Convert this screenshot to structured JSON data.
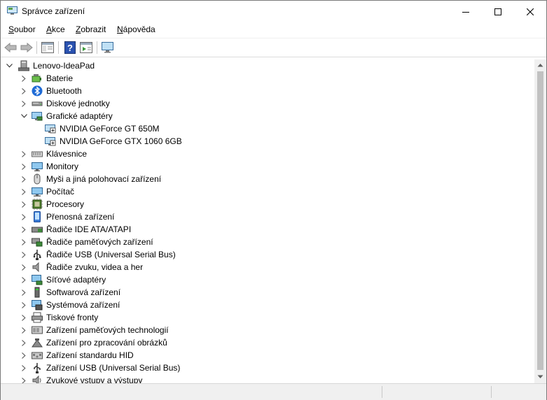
{
  "window": {
    "title": "Správce zařízení"
  },
  "menu": [
    {
      "label": "Soubor",
      "ul": "S",
      "rest": "oubor"
    },
    {
      "label": "Akce",
      "ul": "A",
      "rest": "kce"
    },
    {
      "label": "Zobrazit",
      "ul": "Z",
      "rest": "obrazit"
    },
    {
      "label": "Nápověda",
      "ul": "N",
      "rest": "ápověda"
    }
  ],
  "tree": {
    "root": "Lenovo-IdeaPad",
    "categories": [
      {
        "label": "Baterie",
        "icon": "battery-icon"
      },
      {
        "label": "Bluetooth",
        "icon": "bluetooth-icon"
      },
      {
        "label": "Diskové jednotky",
        "icon": "disk-drive-icon"
      },
      {
        "label": "Grafické adaptéry",
        "icon": "display-adapter-icon",
        "expanded": true,
        "children": [
          "NVIDIA GeForce GT 650M",
          "NVIDIA GeForce GTX 1060 6GB"
        ]
      },
      {
        "label": "Klávesnice",
        "icon": "keyboard-icon"
      },
      {
        "label": "Monitory",
        "icon": "monitor-icon"
      },
      {
        "label": "Myši a jiná polohovací zařízení",
        "icon": "mouse-icon"
      },
      {
        "label": "Počítač",
        "icon": "computer-icon"
      },
      {
        "label": "Procesory",
        "icon": "processor-icon"
      },
      {
        "label": "Přenosná zařízení",
        "icon": "portable-device-icon"
      },
      {
        "label": "Řadiče IDE ATA/ATAPI",
        "icon": "ide-controller-icon"
      },
      {
        "label": "Řadiče paměťových zařízení",
        "icon": "storage-controller-icon"
      },
      {
        "label": "Řadiče USB (Universal Serial Bus)",
        "icon": "usb-icon"
      },
      {
        "label": "Řadiče zvuku, videa a her",
        "icon": "speaker-icon"
      },
      {
        "label": "Síťové adaptéry",
        "icon": "network-adapter-icon"
      },
      {
        "label": "Softwarová zařízení",
        "icon": "software-device-icon"
      },
      {
        "label": "Systémová zařízení",
        "icon": "system-device-icon"
      },
      {
        "label": "Tiskové fronty",
        "icon": "printer-icon"
      },
      {
        "label": "Zařízení paměťových technologií",
        "icon": "memory-technology-icon"
      },
      {
        "label": "Zařízení pro zpracování obrázků",
        "icon": "imaging-device-icon"
      },
      {
        "label": "Zařízení standardu HID",
        "icon": "hid-icon"
      },
      {
        "label": "Zařízení USB (Universal Serial Bus)",
        "icon": "usb-device-icon"
      },
      {
        "label": "Zvukové vstupy a výstupy",
        "icon": "audio-io-icon"
      }
    ]
  }
}
